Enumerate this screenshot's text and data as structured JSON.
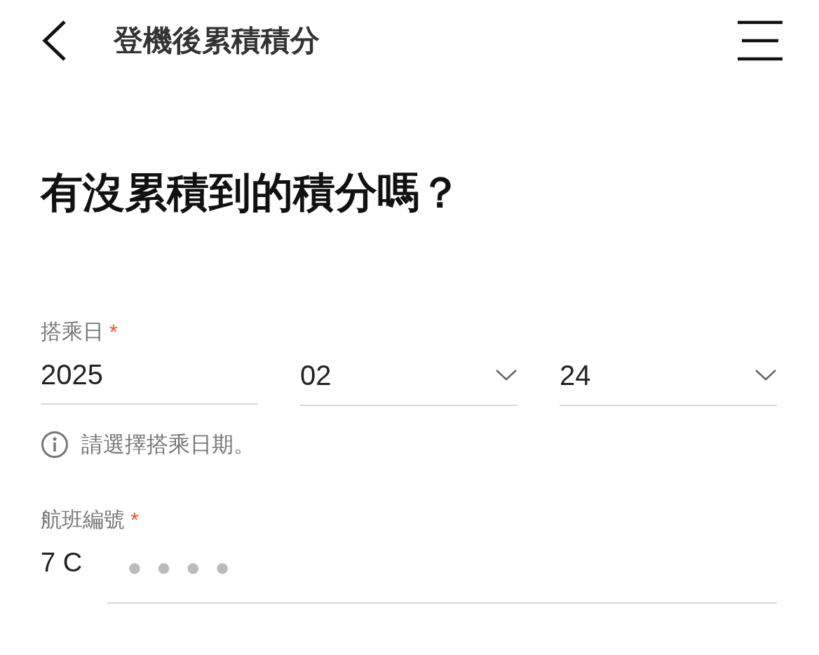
{
  "header": {
    "title": "登機後累積積分"
  },
  "heading": "有沒累積到的積分嗎？",
  "date_section": {
    "label": "搭乘日",
    "required_mark": "*",
    "fields": [
      {
        "kind": "input",
        "value": "2025"
      },
      {
        "kind": "select",
        "value": "02"
      },
      {
        "kind": "select",
        "value": "24"
      }
    ],
    "hint": "請選擇搭乘日期。"
  },
  "flight_section": {
    "label": "航班編號",
    "required_mark": "*",
    "prefix": "7 C",
    "placeholder": "●●●●"
  }
}
